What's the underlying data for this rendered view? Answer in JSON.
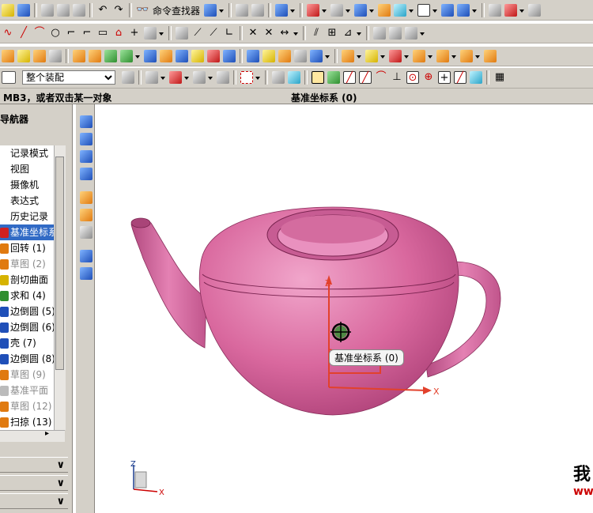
{
  "toolbar": {
    "command_finder_label": "命令查找器",
    "assembly_filter": "整个装配"
  },
  "status": {
    "prompt": "MB3，或者双击某一对象",
    "object": "基准坐标系 (0)"
  },
  "navigator": {
    "title": "导航器",
    "items": [
      {
        "label": "记录模式",
        "icon": "record-icon",
        "state": "normal"
      },
      {
        "label": "视图",
        "icon": "view-icon",
        "state": "normal"
      },
      {
        "label": "摄像机",
        "icon": "camera-icon",
        "state": "normal"
      },
      {
        "label": "表达式",
        "icon": "expression-icon",
        "state": "normal"
      },
      {
        "label": "历史记录",
        "icon": "history-icon",
        "state": "normal"
      },
      {
        "label": "基准坐标系",
        "icon": "datum-csys-icon",
        "state": "selected"
      },
      {
        "label": "回转 (1)",
        "icon": "revolve-icon",
        "state": "normal"
      },
      {
        "label": "草图 (2)",
        "icon": "sketch-icon",
        "state": "dim"
      },
      {
        "label": "剖切曲面",
        "icon": "section-surface-icon",
        "state": "normal"
      },
      {
        "label": "求和 (4)",
        "icon": "unite-icon",
        "state": "normal"
      },
      {
        "label": "边倒圆 (5)",
        "icon": "edge-blend-icon",
        "state": "normal"
      },
      {
        "label": "边倒圆 (6)",
        "icon": "edge-blend-icon",
        "state": "normal"
      },
      {
        "label": "壳 (7)",
        "icon": "shell-icon",
        "state": "normal"
      },
      {
        "label": "边倒圆 (8)",
        "icon": "edge-blend-icon",
        "state": "normal"
      },
      {
        "label": "草图 (9)",
        "icon": "sketch-icon",
        "state": "dim"
      },
      {
        "label": "基准平面",
        "icon": "datum-plane-icon",
        "state": "dim"
      },
      {
        "label": "草图 (12)",
        "icon": "sketch-icon",
        "state": "dim"
      },
      {
        "label": "扫掠 (13)",
        "icon": "sweep-icon",
        "state": "normal"
      }
    ]
  },
  "viewport": {
    "tooltip": "基准坐标系 (0)",
    "axis_z": "Z",
    "axis_x": "X",
    "triad_z": "Z",
    "triad_x": "X",
    "model_color": "#d9689e",
    "axis_color": "#e2412c",
    "watermark_line1": "我",
    "watermark_line2": "ww"
  }
}
